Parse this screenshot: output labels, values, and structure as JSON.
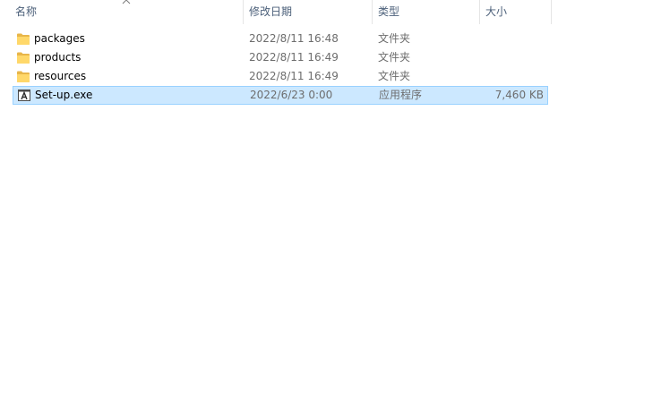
{
  "columns": {
    "name": "名称",
    "date": "修改日期",
    "type": "类型",
    "size": "大小"
  },
  "sort": {
    "column": "name",
    "direction": "ascending"
  },
  "files": [
    {
      "name": "packages",
      "date": "2022/8/11 16:48",
      "type": "文件夹",
      "size": "",
      "icon": "folder-icon",
      "selected": false
    },
    {
      "name": "products",
      "date": "2022/8/11 16:49",
      "type": "文件夹",
      "size": "",
      "icon": "folder-icon",
      "selected": false
    },
    {
      "name": "resources",
      "date": "2022/8/11 16:49",
      "type": "文件夹",
      "size": "",
      "icon": "folder-icon",
      "selected": false
    },
    {
      "name": "Set-up.exe",
      "date": "2022/6/23 0:00",
      "type": "应用程序",
      "size": "7,460 KB",
      "icon": "adobe-installer-icon",
      "selected": true
    }
  ],
  "colors": {
    "selection_bg": "#cce8ff",
    "selection_border": "#99d1ff",
    "folder": "#ffd86a",
    "header_text": "#4c607a",
    "secondary_text": "#6d6d6d"
  }
}
